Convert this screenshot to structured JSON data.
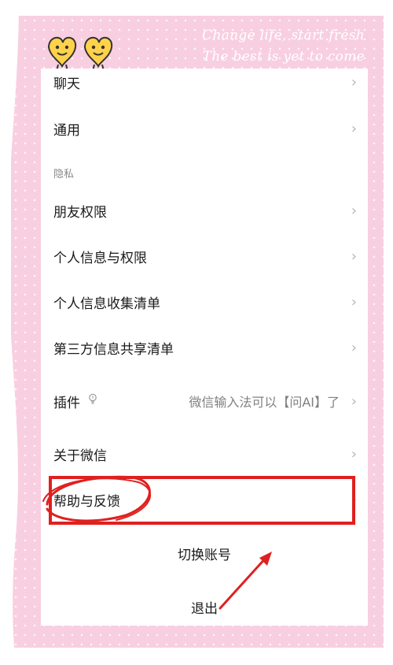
{
  "decor": {
    "slogan_line1": "Change life, start fresh",
    "slogan_line2": "The best is yet to come"
  },
  "settings": {
    "chat": "聊天",
    "general": "通用",
    "privacy_section": "隐私",
    "friend_permissions": "朋友权限",
    "personal_info_permissions": "个人信息与权限",
    "personal_info_collection": "个人信息收集清单",
    "third_party_sharing": "第三方信息共享清单",
    "plugins": "插件",
    "plugins_hint": "微信输入法可以【问AI】了",
    "about": "关于微信",
    "help_feedback": "帮助与反馈",
    "switch_account": "切换账号",
    "logout": "退出"
  },
  "icons": {
    "chevron": "chevron-right-icon",
    "bulb": "bulb-icon"
  },
  "colors": {
    "frame_pink": "#f8cfe0",
    "annotation_red": "#e02020"
  }
}
